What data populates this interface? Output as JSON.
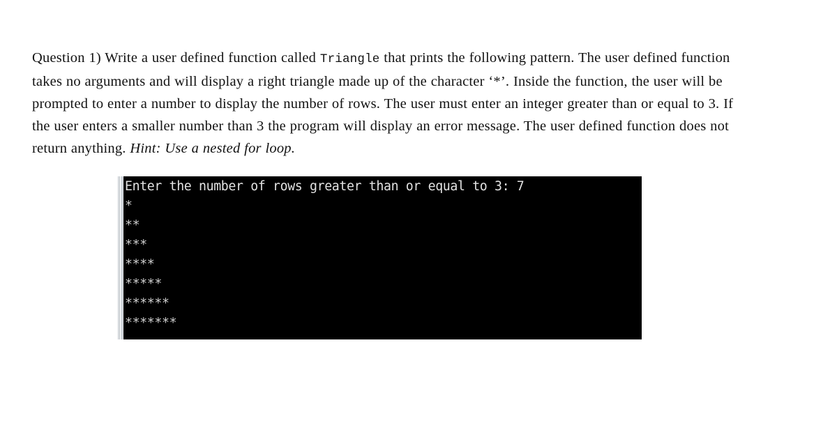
{
  "question": {
    "segments": [
      {
        "type": "text",
        "value": "Question 1) Write a user defined function called "
      },
      {
        "type": "code",
        "value": "Triangle"
      },
      {
        "type": "text",
        "value": " that prints the following pattern. The user defined function takes no arguments and will display a right triangle made up of the character ‘*’. Inside the function, the user will be prompted to enter a number to display the number of rows. The user must enter an integer greater than or equal to 3. If the user enters a smaller number than 3 the program will display an error message. The user defined function does not return anything. "
      },
      {
        "type": "hint",
        "value": "Hint: Use a nested for loop."
      }
    ],
    "full_text": "Question 1) Write a user defined function called Triangle that prints the following pattern. The user defined function takes no arguments and will display a right triangle made up of the character ‘*’. Inside the function, the user will be prompted to enter a number to display the number of rows. The user must enter an integer greater than or equal to 3. If the user enters a smaller number than 3 the program will display an error message. The user defined function does not return anything. Hint: Use a nested for loop.",
    "code_identifier": "Triangle",
    "hint": "Hint: Use a nested for loop.",
    "min_rows": "3"
  },
  "console": {
    "background_color": "#000000",
    "text_color": "#d9d9d9",
    "prompt_label": "Enter the number of rows greater than or equal to 3: ",
    "entered_value": "7",
    "prompt_line": "Enter the number of rows greater than or equal to 3: 7",
    "pattern_character": "*",
    "row_count": 7,
    "output_lines": [
      "*",
      "**",
      "***",
      "****",
      "*****",
      "******",
      "*******"
    ]
  }
}
